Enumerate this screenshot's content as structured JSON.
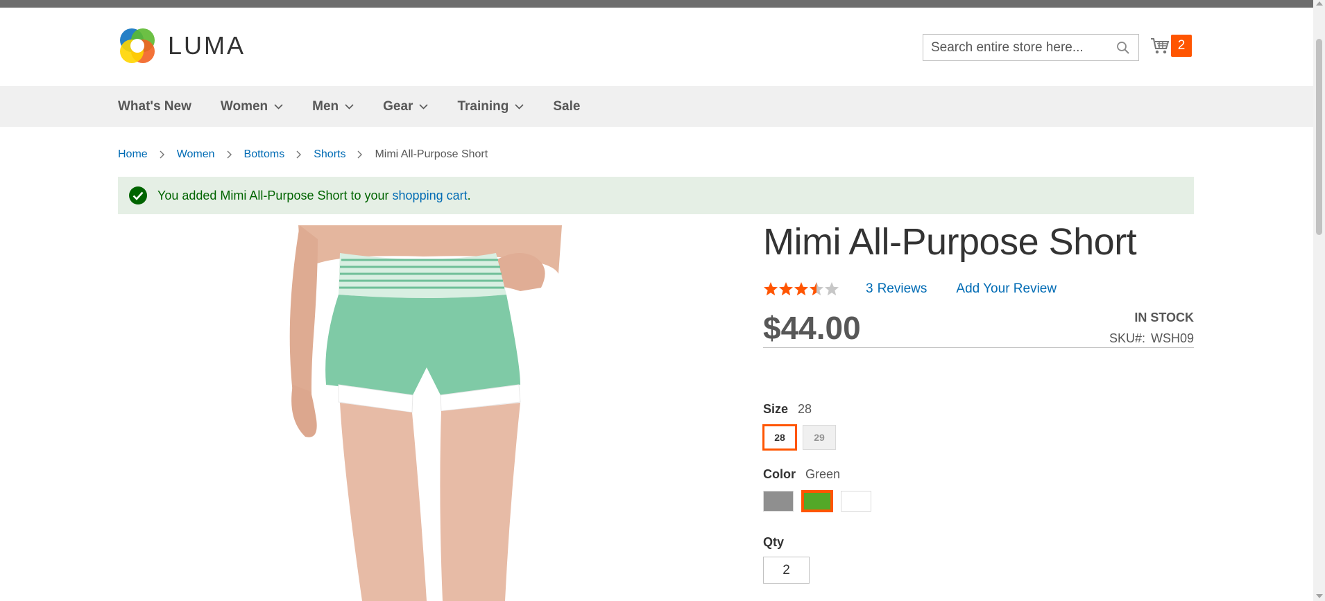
{
  "header": {
    "logo_text": "LUMA",
    "search_placeholder": "Search entire store here...",
    "cart_count": "2"
  },
  "nav": {
    "items": [
      {
        "label": "What's New",
        "has_dropdown": false
      },
      {
        "label": "Women",
        "has_dropdown": true
      },
      {
        "label": "Men",
        "has_dropdown": true
      },
      {
        "label": "Gear",
        "has_dropdown": true
      },
      {
        "label": "Training",
        "has_dropdown": true
      },
      {
        "label": "Sale",
        "has_dropdown": false
      }
    ]
  },
  "breadcrumbs": {
    "items": [
      "Home",
      "Women",
      "Bottoms",
      "Shorts"
    ],
    "current": "Mimi All-Purpose Short"
  },
  "message": {
    "text": "You added Mimi All-Purpose Short to your ",
    "link": "shopping cart",
    "suffix": "."
  },
  "product": {
    "title": "Mimi All-Purpose Short",
    "rating_stars": 3.5,
    "rating_max": 5,
    "reviews_count": "3",
    "reviews_label": "Reviews",
    "add_review_label": "Add Your Review",
    "price": "$44.00",
    "stock_status": "IN STOCK",
    "sku_label": "SKU#:",
    "sku": "WSH09"
  },
  "options": {
    "size": {
      "label": "Size",
      "selected": "28",
      "swatches": [
        "28",
        "29"
      ]
    },
    "color": {
      "label": "Color",
      "selected": "Green",
      "swatches": [
        {
          "name": "Gray",
          "hex": "#8f8f8f"
        },
        {
          "name": "Green",
          "hex": "#53a828"
        },
        {
          "name": "White",
          "hex": "#ffffff"
        }
      ]
    },
    "qty": {
      "label": "Qty",
      "value": "2"
    }
  },
  "colors": {
    "accent": "#ff5501",
    "link": "#006bb4",
    "success_bg": "#e5efe5",
    "success_text": "#006400",
    "star": "#ff5501"
  }
}
